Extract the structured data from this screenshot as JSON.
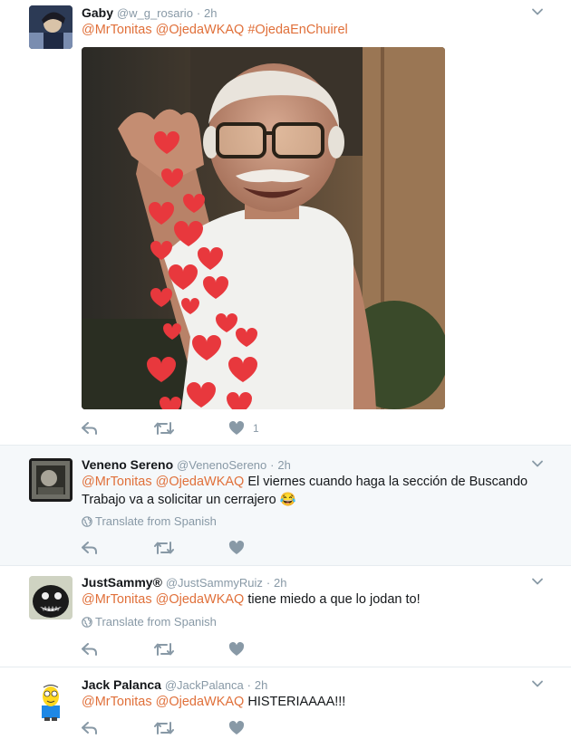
{
  "icons": {
    "reply": "reply-icon",
    "retweet": "retweet-icon",
    "like": "heart-icon",
    "more": "chevron-down-icon",
    "globe": "globe-icon"
  },
  "colors": {
    "link": "#e0703a",
    "muted": "#8899a6",
    "highlight_bg": "#f5f8fa"
  },
  "tweets": [
    {
      "name": "Gaby",
      "handle": "@w_g_rosario",
      "dot": "·",
      "time": "2h",
      "mentions": "@MrTonitas @OjedaWKAQ #OjedaEnChuirel",
      "text": "",
      "has_media": true,
      "likes": "1"
    },
    {
      "name": "Veneno Sereno",
      "handle": "@VenenoSereno",
      "dot": "·",
      "time": "2h",
      "mentions": "@MrTonitas @OjedaWKAQ",
      "text": " El viernes cuando haga la sección de Buscando Trabajo va a solicitar un cerrajero 😂",
      "translate": "Translate from Spanish",
      "likes": ""
    },
    {
      "name": "JustSammy®",
      "handle": "@JustSammyRuiz",
      "dot": "·",
      "time": "2h",
      "mentions": "@MrTonitas @OjedaWKAQ",
      "text": " tiene miedo a que lo jodan to!",
      "translate": "Translate from Spanish",
      "likes": ""
    },
    {
      "name": "Jack Palanca",
      "handle": "@JackPalanca",
      "dot": "·",
      "time": "2h",
      "mentions": "@MrTonitas @OjedaWKAQ",
      "text": " HISTERIAAAA!!!",
      "likes": ""
    }
  ]
}
